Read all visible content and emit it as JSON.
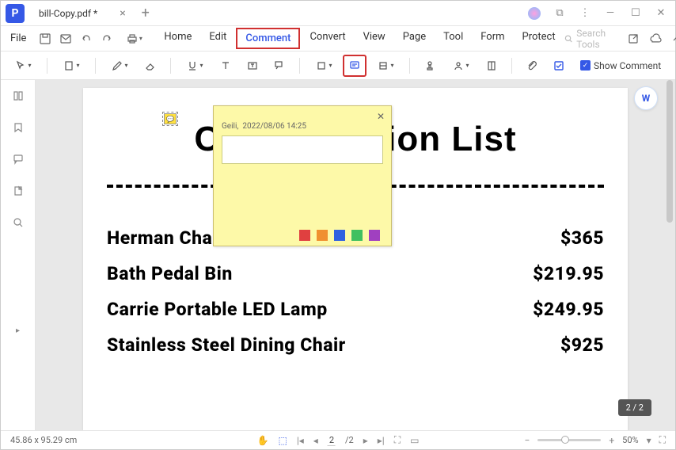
{
  "app": {
    "icon_letter": "P"
  },
  "tab": {
    "filename": "bill-Copy.pdf *"
  },
  "menu": {
    "file": "File",
    "tabs": {
      "home": "Home",
      "edit": "Edit",
      "comment": "Comment",
      "convert": "Convert",
      "view": "View",
      "page": "Page",
      "tool": "Tool",
      "form": "Form",
      "protect": "Protect"
    },
    "search_placeholder": "Search Tools"
  },
  "toolbar": {
    "show_comment": "Show Comment"
  },
  "document": {
    "title_left": "C",
    "title_right": "ion List",
    "items": [
      {
        "name": "Herman Chair",
        "price": "$365"
      },
      {
        "name": "Bath Pedal Bin",
        "price": "$219.95"
      },
      {
        "name": "Carrie Portable LED Lamp",
        "price": "$249.95"
      },
      {
        "name": "Stainless Steel Dining Chair",
        "price": "$925"
      }
    ]
  },
  "sticky": {
    "author": "Geili",
    "date": "2022/08/06 14:25",
    "colors": [
      "#f0d040",
      "#e04040",
      "#f09030",
      "#3060e0",
      "#40c060",
      "#a040c0"
    ]
  },
  "page_indicator": "2 / 2",
  "status": {
    "dimensions": "45.86 x 95.29 cm",
    "page_current": "2",
    "page_total": "/2",
    "zoom": "50%"
  }
}
